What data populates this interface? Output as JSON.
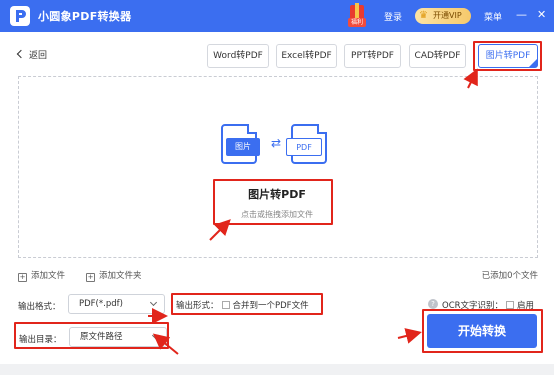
{
  "app": {
    "title": "小圆象PDF转换器",
    "gift_tag": "福利",
    "login_label": "登录",
    "vip_label": "开通VIP",
    "menu_label": "菜单",
    "minimize_glyph": "—",
    "close_glyph": "✕"
  },
  "nav": {
    "back_label": "返回"
  },
  "tabs": [
    {
      "label": "Word转PDF",
      "active": false
    },
    {
      "label": "Excel转PDF",
      "active": false
    },
    {
      "label": "PPT转PDF",
      "active": false
    },
    {
      "label": "CAD转PDF",
      "active": false
    },
    {
      "label": "图片转PDF",
      "active": true
    }
  ],
  "dropzone": {
    "source_badge": "图片",
    "target_badge": "PDF",
    "arrows_glyph": "⇄",
    "title": "图片转PDF",
    "hint": "点击或拖拽添加文件"
  },
  "file_actions": {
    "add_file_label": "添加文件",
    "add_folder_label": "添加文件夹",
    "added_count_text": "已添加0个文件"
  },
  "options": {
    "output_format_label": "输出格式：",
    "output_format_value": "PDF(*.pdf)",
    "output_mode_label": "输出形式：",
    "merge_label": "合并到一个PDF文件",
    "ocr_label": "OCR文字识别：",
    "ocr_help_glyph": "?",
    "ocr_enable_label": "启用",
    "output_dir_label": "输出目录：",
    "output_dir_value": "原文件路径"
  },
  "start_button_label": "开始转换",
  "colors": {
    "accent": "#3b6ef0",
    "annotation": "#e1251b",
    "vip_gold": "#f6c96b"
  },
  "icons": [
    "app-logo-icon",
    "gift-icon",
    "crown-icon",
    "chevron-left-icon",
    "image-file-icon",
    "pdf-file-icon",
    "convert-arrows-icon",
    "add-file-icon",
    "add-folder-icon",
    "help-icon",
    "chevron-down-icon"
  ]
}
